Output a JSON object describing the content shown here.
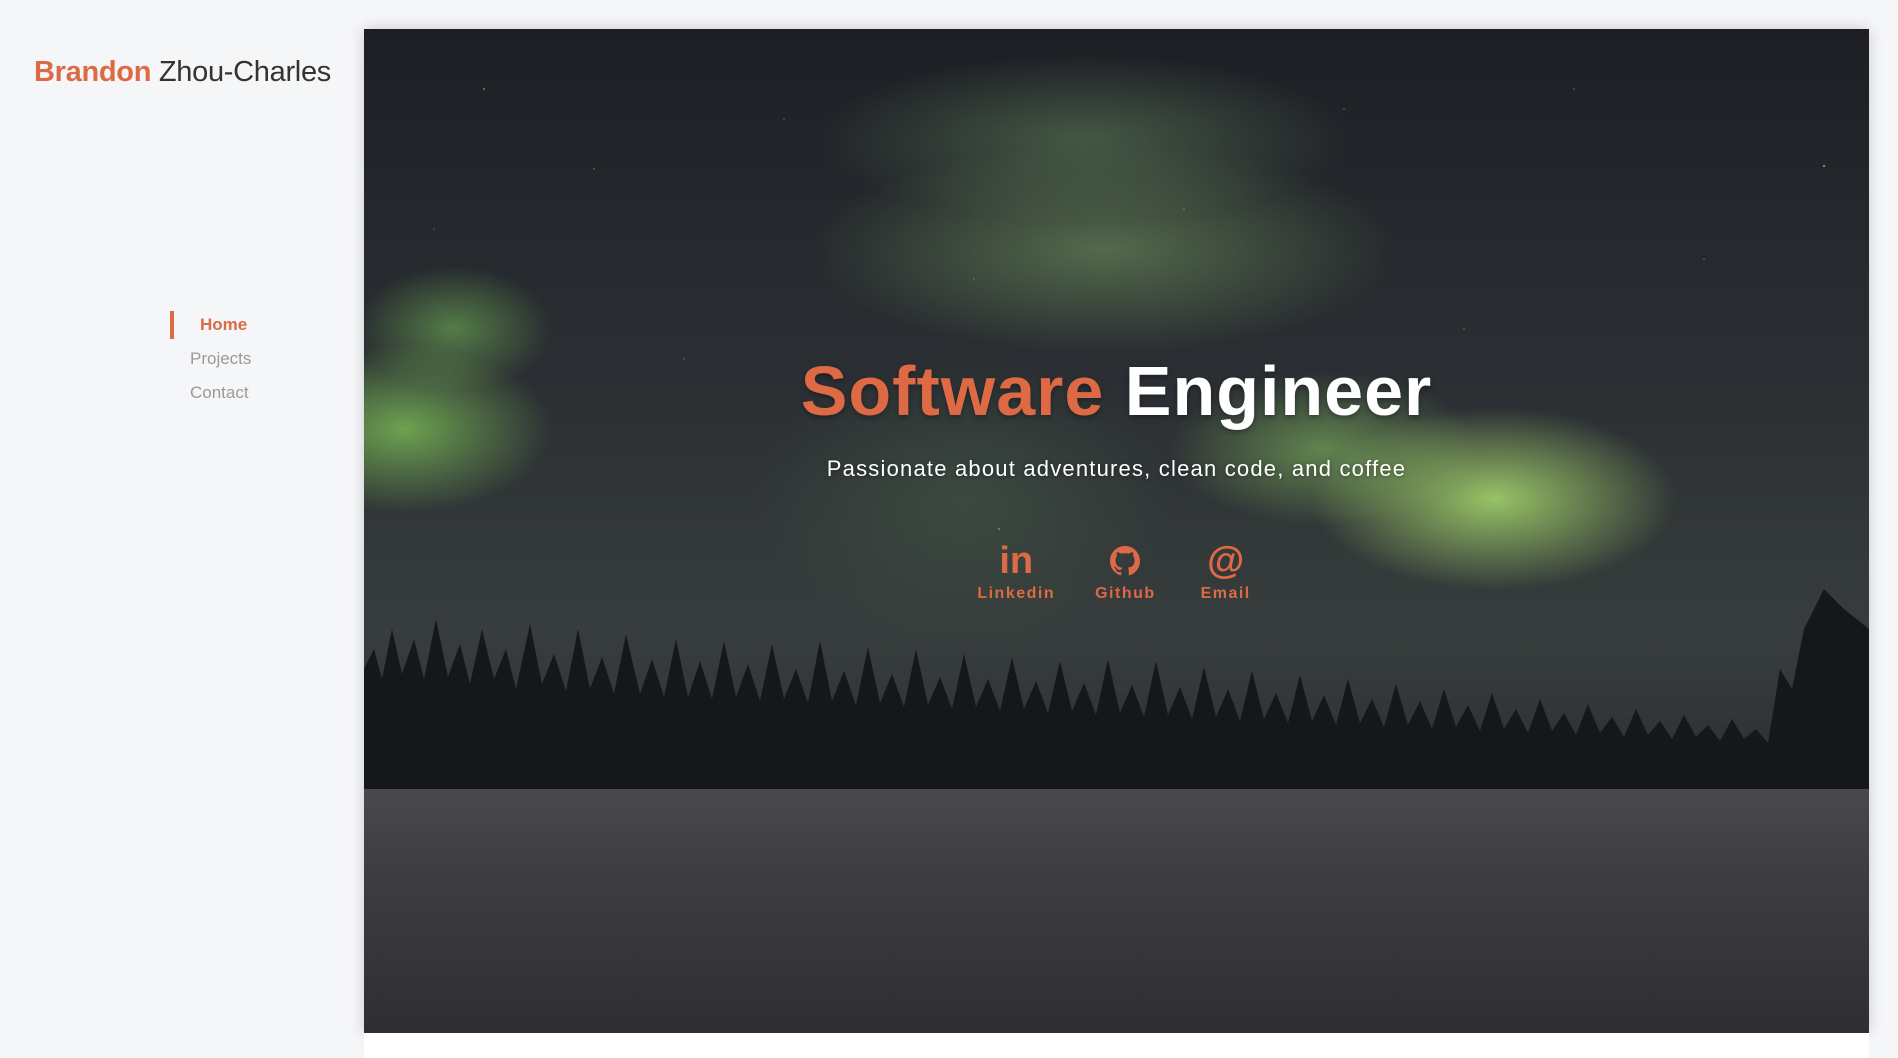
{
  "brand": {
    "first": "Brandon",
    "last": "Zhou-Charles"
  },
  "nav": {
    "items": [
      {
        "label": "Home",
        "active": true
      },
      {
        "label": "Projects",
        "active": false
      },
      {
        "label": "Contact",
        "active": false
      }
    ]
  },
  "hero": {
    "title_accent": "Software",
    "title_plain": "Engineer",
    "subtitle": "Passionate about adventures, clean code, and coffee",
    "background": "northern-lights-night-photo",
    "socials": [
      {
        "icon": "linkedin-icon",
        "glyph": "in",
        "label": "Linkedin"
      },
      {
        "icon": "github-icon",
        "glyph": "",
        "label": "Github"
      },
      {
        "icon": "email-icon",
        "glyph": "@",
        "label": "Email"
      }
    ]
  },
  "colors": {
    "accent": "#de6a45",
    "sidebar_bg": "#f5f6f8",
    "nav_inactive": "#9a9a9a",
    "hero_text": "#ffffff"
  }
}
